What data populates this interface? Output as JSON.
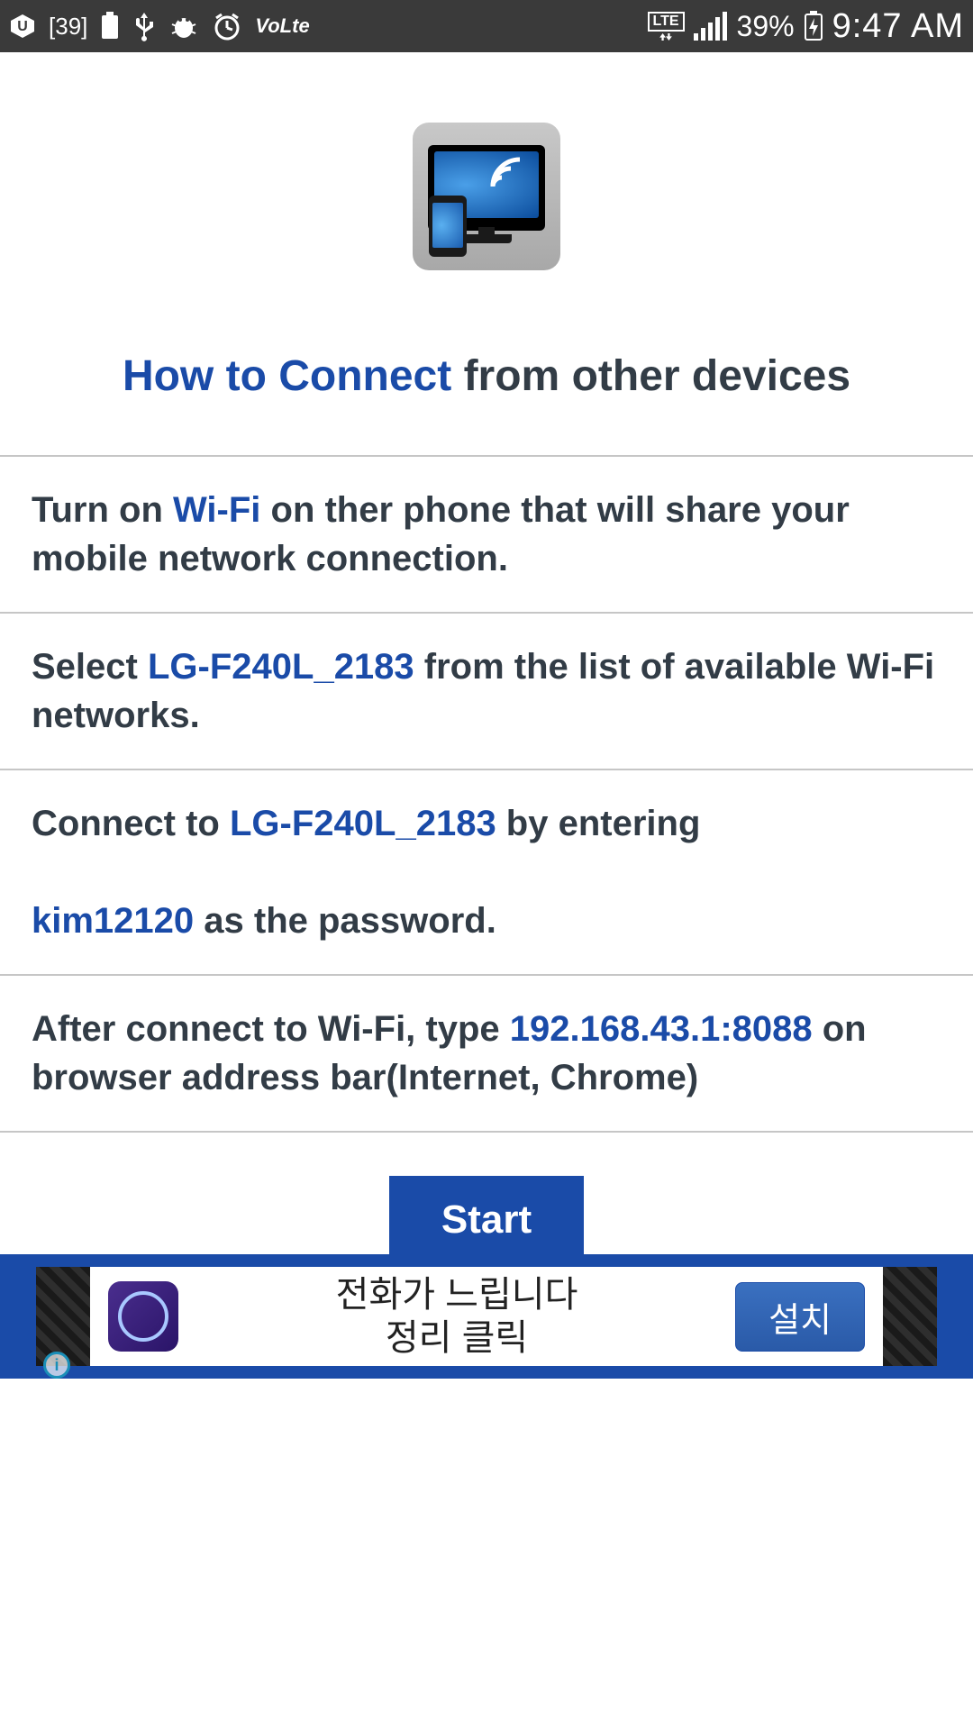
{
  "status": {
    "left_badge": "39",
    "volte": "VoLte",
    "lte_label": "LTE",
    "battery_pct": "39%",
    "time": "9:47 AM"
  },
  "title": {
    "highlight": "How to Connect",
    "rest": " from other devices"
  },
  "steps": {
    "s1": {
      "pre": "Turn on ",
      "hl": "Wi-Fi",
      "post": " on ther phone that will share your mobile network connection."
    },
    "s2": {
      "pre": "Select ",
      "hl": "LG-F240L_2183",
      "post": " from the list of available Wi-Fi networks."
    },
    "s3": {
      "pre": "Connect to ",
      "hl1": "LG-F240L_2183",
      "mid": " by entering",
      "hl2": "kim12120",
      "post": " as the password."
    },
    "s4": {
      "pre": "After connect to Wi-Fi, type ",
      "hl": "192.168.43.1:8088",
      "post": " on browser address bar(Internet, Chrome)"
    }
  },
  "start_label": "Start",
  "ad": {
    "line1": "전화가 느립니다",
    "line2": "정리 클릭",
    "button": "설치"
  }
}
